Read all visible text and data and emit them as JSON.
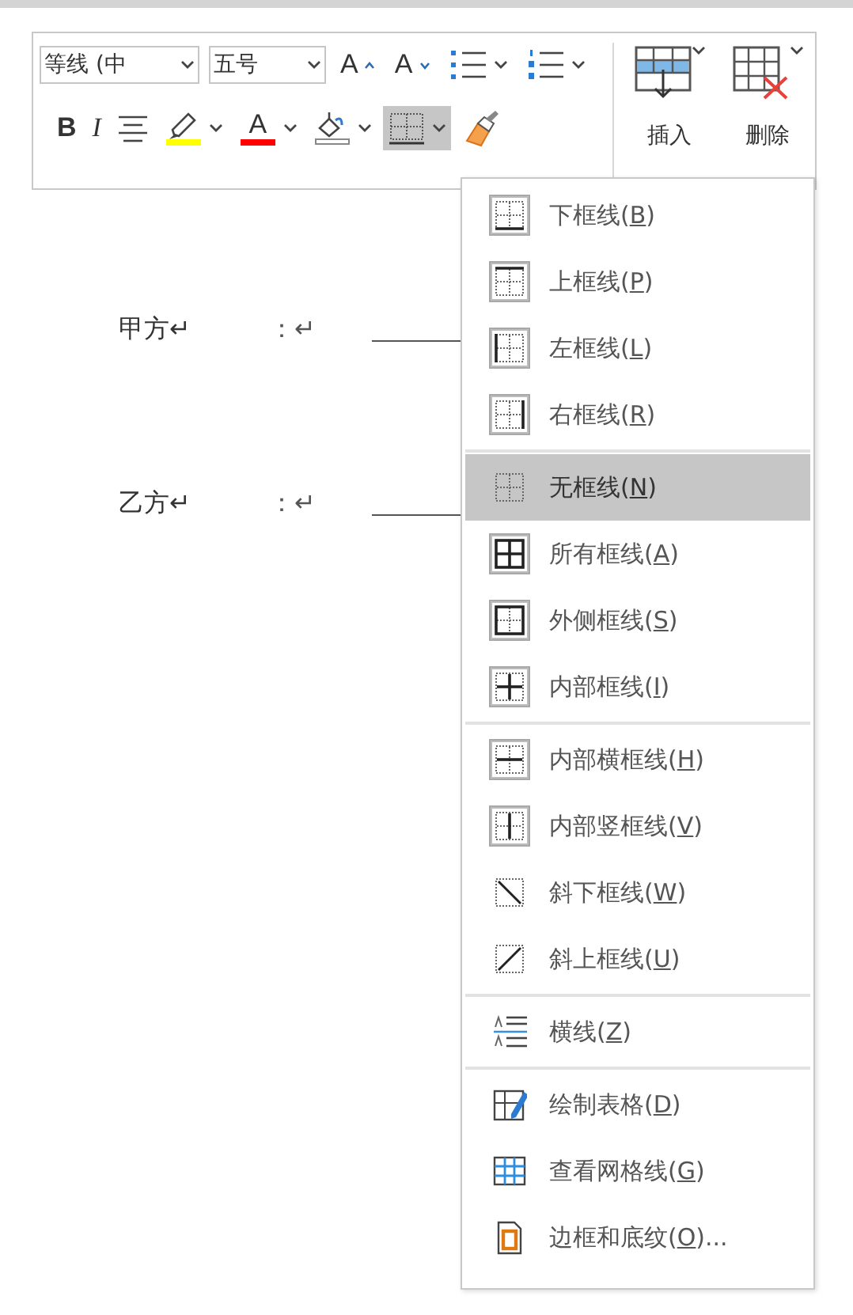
{
  "toolbar": {
    "font_name": {
      "value": "等线 (中"
    },
    "font_size": {
      "value": "五号"
    },
    "row1_tools": [
      {
        "kind": "grow_font",
        "glyph": "A",
        "has_menu": false
      },
      {
        "kind": "shrink_font",
        "glyph": "A",
        "has_menu": false
      },
      {
        "kind": "bullets",
        "has_menu": true
      },
      {
        "kind": "numbering",
        "has_menu": true
      }
    ],
    "row2_tools": [
      {
        "kind": "bold",
        "glyph": "B",
        "pressed": false,
        "has_menu": false
      },
      {
        "kind": "italic",
        "glyph": "I",
        "pressed": false,
        "has_menu": false
      },
      {
        "kind": "align_center",
        "pressed": false,
        "has_menu": false
      },
      {
        "kind": "highlight",
        "color": "#ffff00",
        "pressed": false,
        "has_menu": true
      },
      {
        "kind": "font_color",
        "glyph": "A",
        "color": "#ff0000",
        "pressed": false,
        "has_menu": true
      },
      {
        "kind": "shading",
        "pressed": false,
        "has_menu": true
      },
      {
        "kind": "borders",
        "pressed": true,
        "has_menu": true
      },
      {
        "kind": "format_painter",
        "pressed": false,
        "has_menu": false
      }
    ],
    "table_buttons": [
      {
        "kind": "insert",
        "label": "插入"
      },
      {
        "kind": "delete",
        "label": "删除"
      }
    ]
  },
  "document": {
    "lines": [
      {
        "party": "甲方↵",
        "colon": "：↵"
      },
      {
        "party": "乙方↵",
        "colon": "：↵"
      }
    ]
  },
  "borders_menu": {
    "groups": [
      {
        "items": [
          {
            "kind": "bottom",
            "label": "下框线(B)",
            "checked": true,
            "selected": false
          },
          {
            "kind": "top",
            "label": "上框线(P)",
            "checked": true,
            "selected": false
          },
          {
            "kind": "left",
            "label": "左框线(L)",
            "checked": true,
            "selected": false
          },
          {
            "kind": "right",
            "label": "右框线(R)",
            "checked": true,
            "selected": false
          }
        ]
      },
      {
        "items": [
          {
            "kind": "none",
            "label": "无框线(N)",
            "checked": false,
            "selected": true
          },
          {
            "kind": "all",
            "label": "所有框线(A)",
            "checked": true,
            "selected": false
          },
          {
            "kind": "outside",
            "label": "外侧框线(S)",
            "checked": true,
            "selected": false
          },
          {
            "kind": "inside",
            "label": "内部框线(I)",
            "checked": true,
            "selected": false
          }
        ]
      },
      {
        "items": [
          {
            "kind": "inside_h",
            "label": "内部横框线(H)",
            "checked": true,
            "selected": false
          },
          {
            "kind": "inside_v",
            "label": "内部竖框线(V)",
            "checked": true,
            "selected": false
          },
          {
            "kind": "diag_down",
            "label": "斜下框线(W)",
            "checked": false,
            "selected": false
          },
          {
            "kind": "diag_up",
            "label": "斜上框线(U)",
            "checked": false,
            "selected": false
          }
        ]
      },
      {
        "items": [
          {
            "kind": "hline",
            "label": "横线(Z)",
            "checked": false,
            "selected": false
          }
        ]
      },
      {
        "items": [
          {
            "kind": "draw",
            "label": "绘制表格(D)",
            "checked": false,
            "selected": false
          },
          {
            "kind": "grid",
            "label": "查看网格线(G)",
            "checked": false,
            "selected": false
          },
          {
            "kind": "dialog",
            "label": "边框和底纹(O)...",
            "checked": false,
            "selected": false
          }
        ]
      }
    ]
  }
}
